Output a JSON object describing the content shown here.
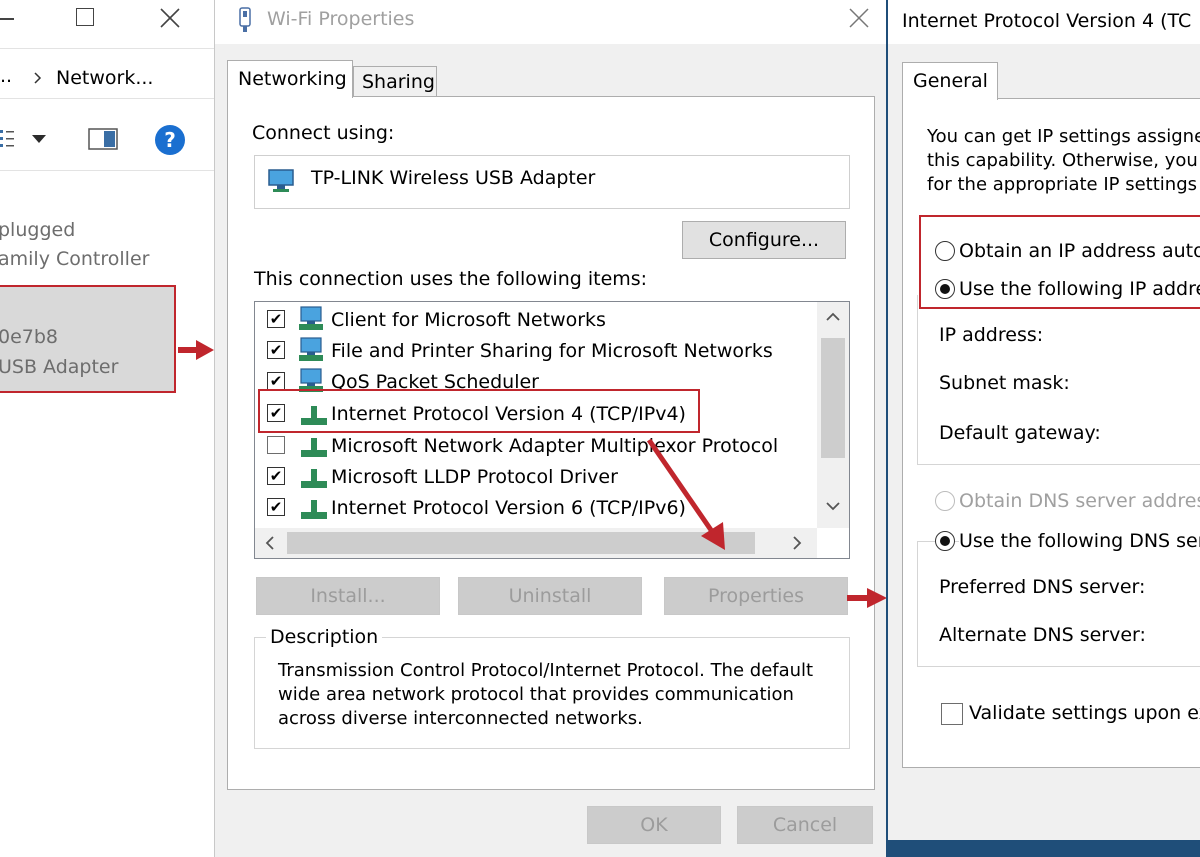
{
  "left_window": {
    "breadcrumb": "Network...",
    "line1": "plugged",
    "line2": "amily Controller",
    "selected_line1": "0e7b8",
    "selected_line2": "USB Adapter"
  },
  "wifi_dialog": {
    "title": "Wi-Fi Properties",
    "tabs": [
      "Networking",
      "Sharing"
    ],
    "connect_using_label": "Connect using:",
    "adapter_name": "TP-LINK Wireless USB Adapter",
    "configure_button": "Configure...",
    "items_label": "This connection uses the following items:",
    "items": [
      {
        "label": "Client for Microsoft Networks",
        "checked": true
      },
      {
        "label": "File and Printer Sharing for Microsoft Networks",
        "checked": true
      },
      {
        "label": "QoS Packet Scheduler",
        "checked": true
      },
      {
        "label": "Internet Protocol Version 4 (TCP/IPv4)",
        "checked": true
      },
      {
        "label": "Microsoft Network Adapter Multiplexor Protocol",
        "checked": false
      },
      {
        "label": "Microsoft LLDP Protocol Driver",
        "checked": true
      },
      {
        "label": "Internet Protocol Version 6 (TCP/IPv6)",
        "checked": true
      }
    ],
    "install_button": "Install...",
    "uninstall_button": "Uninstall",
    "properties_button": "Properties",
    "description_label": "Description",
    "description_text": [
      "Transmission Control Protocol/Internet Protocol. The default",
      "wide area network protocol that provides communication",
      "across diverse interconnected networks."
    ],
    "ok_button": "OK",
    "cancel_button": "Cancel"
  },
  "ipv4_dialog": {
    "title": "Internet Protocol Version 4 (TC",
    "tab": "General",
    "intro": [
      "You can get IP settings assigne",
      "this capability. Otherwise, you",
      "for the appropriate IP settings"
    ],
    "radio_auto_ip": "Obtain an IP address auto",
    "radio_static_ip": "Use the following IP addre",
    "ip_address_label": "IP address:",
    "subnet_label": "Subnet mask:",
    "gateway_label": "Default gateway:",
    "radio_auto_dns": "Obtain DNS server addres",
    "radio_static_dns": "Use the following DNS ser",
    "preferred_dns_label": "Preferred DNS server:",
    "alternate_dns_label": "Alternate DNS server:",
    "validate_label": "Validate settings upon ex"
  },
  "colors": {
    "highlight_red": "#c0262d",
    "help_blue": "#1a6fd0",
    "network_green": "#2e8b57"
  }
}
